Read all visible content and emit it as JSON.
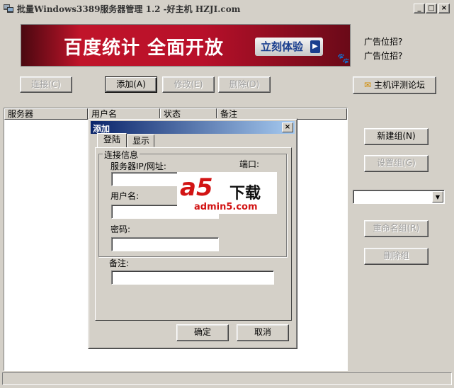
{
  "window": {
    "title": "批量Windows3389服务器管理 1.2 -好主机 HZJI.com",
    "minimize": "_",
    "maximize": "□",
    "close": "×"
  },
  "banner": {
    "text": "百度统计 全面开放",
    "cta": "立刻体验",
    "arrow": "▶"
  },
  "ads": [
    "广告位招?",
    "广告位招?"
  ],
  "toolbar": {
    "connect": "连接(C)",
    "add": "添加(A)",
    "modify": "修改(E)",
    "delete": "删除(D)",
    "forum": "主机评测论坛"
  },
  "list": {
    "columns": [
      "服务器",
      "用户名",
      "状态",
      "备注"
    ]
  },
  "side": {
    "new_group": "新建组(N)",
    "set_group": "设置组(G)",
    "rename_group": "重命名组(R)",
    "delete_group": "删除组",
    "combo_value": ""
  },
  "dialog": {
    "title": "添加",
    "close": "×",
    "tabs": [
      "登陆",
      "显示"
    ],
    "group_label": "连接信息",
    "server_label": "服务器IP/网址:",
    "port_label": "端口:",
    "user_label": "用户名:",
    "password_label": "密码:",
    "note_label": "备注:",
    "ok": "确定",
    "cancel": "取消"
  },
  "watermark": {
    "logo": "a5",
    "text": "下载",
    "site": "admin5.com"
  }
}
